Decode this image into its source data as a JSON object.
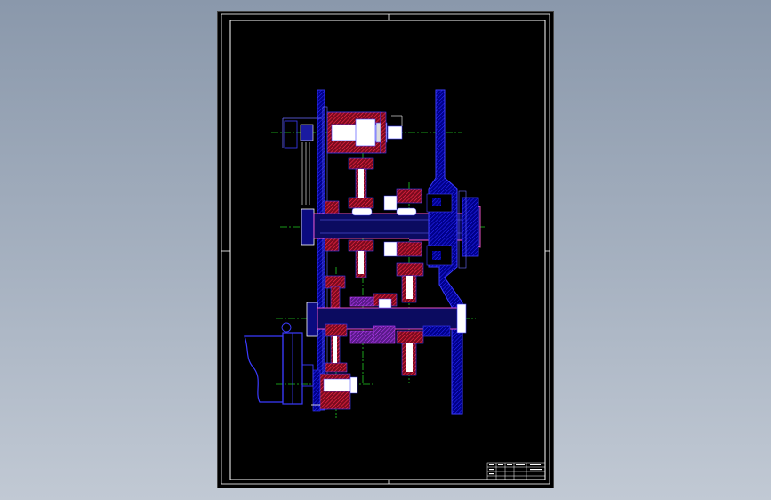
{
  "viewport": {
    "background_colors": [
      "#8a98ab",
      "#c1c9d4"
    ]
  },
  "drawing": {
    "sheet_color": "#000000",
    "colors": {
      "border": "#ffffff",
      "outline": "#3b3bff",
      "outline_light": "#6a6aff",
      "hatch": "#c8102e",
      "section_fill": "#0000a8",
      "centerline": "#22cc22",
      "shaft": "#ff5ad8",
      "spline": "#c040ff",
      "fill_white": "#ffffff"
    },
    "components": [
      {
        "name": "top-shaft-housing"
      },
      {
        "name": "main-shaft"
      },
      {
        "name": "lower-shaft"
      },
      {
        "name": "gear-set"
      },
      {
        "name": "side-plate"
      },
      {
        "name": "motor-housing"
      },
      {
        "name": "output-flange"
      }
    ]
  },
  "title_block": {
    "rows": 4,
    "columns": 5
  }
}
